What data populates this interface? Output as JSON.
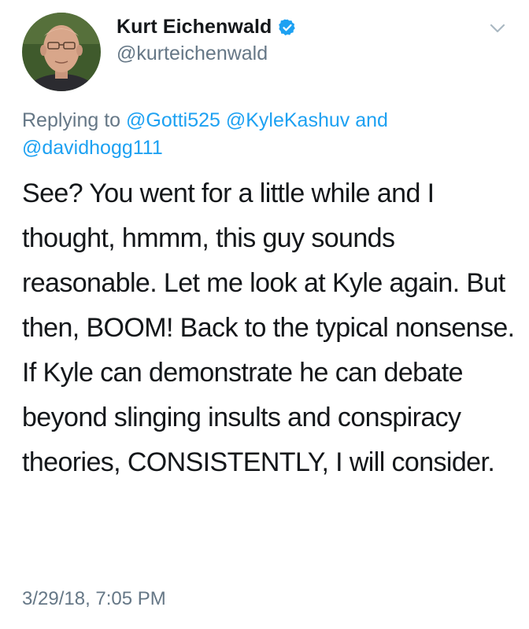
{
  "author": {
    "name": "Kurt Eichenwald",
    "handle": "@kurteichenwald",
    "verified": true,
    "verified_color": "#1da1f2"
  },
  "reply": {
    "prefix": "Replying to",
    "mentions": [
      "@Gotti525",
      "@KyleKashuv",
      "@davidhogg111"
    ],
    "conjunction": "and"
  },
  "tweet": {
    "text": "See? You went for a little while and I thought, hmmm, this guy sounds reasonable. Let me look at Kyle again. But then, BOOM! Back to the typical nonsense. If Kyle can demonstrate he can debate beyond slinging insults and conspiracy theories, CONSISTENTLY, I will consider.",
    "timestamp": "3/29/18, 7:05 PM"
  },
  "icons": {
    "menu": "chevron-down-icon",
    "verified": "verified-badge-icon",
    "avatar": "avatar"
  },
  "colors": {
    "text": "#14171a",
    "secondary": "#657786",
    "link": "#1da1f2"
  }
}
